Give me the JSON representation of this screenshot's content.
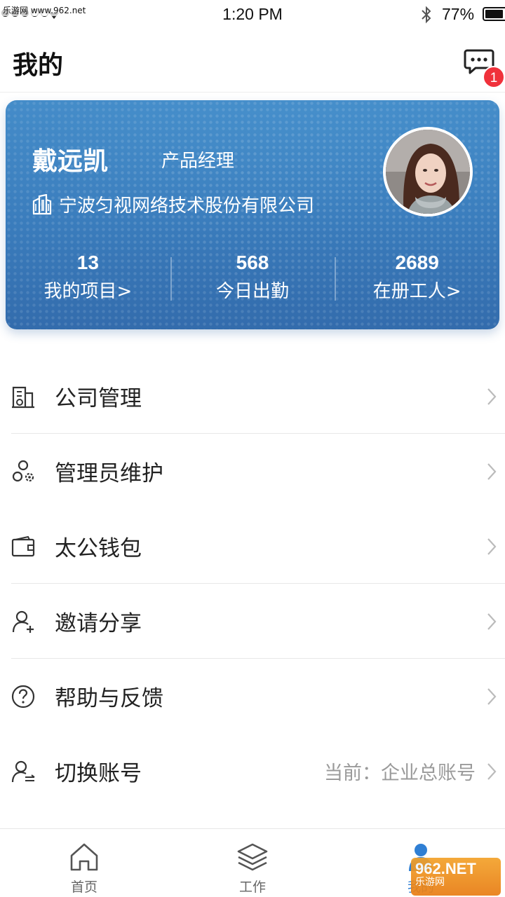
{
  "status_bar": {
    "watermark": "乐游网 www.962.net",
    "time": "1:20 PM",
    "battery": "77%",
    "battery_level": 0.77
  },
  "header": {
    "title": "我的",
    "message_badge": "1"
  },
  "profile": {
    "name": "戴远凯",
    "role": "产品经理",
    "company": "宁波匀视网络技术股份有限公司",
    "stats": [
      {
        "value": "13",
        "label": "我的项目>"
      },
      {
        "value": "568",
        "label": "今日出勤"
      },
      {
        "value": "2689",
        "label": "在册工人>"
      }
    ]
  },
  "menu": {
    "items": [
      {
        "label": "公司管理",
        "icon": "company-building-icon"
      },
      {
        "label": "管理员维护",
        "icon": "admin-gear-icon"
      },
      {
        "label": "太公钱包",
        "icon": "wallet-icon"
      },
      {
        "label": "邀请分享",
        "icon": "invite-user-icon"
      },
      {
        "label": "帮助与反馈",
        "icon": "help-icon"
      },
      {
        "label": "切换账号",
        "icon": "switch-account-icon",
        "value": "当前：企业总账号"
      }
    ]
  },
  "tabbar": {
    "tabs": [
      {
        "label": "首页",
        "icon": "home-icon"
      },
      {
        "label": "工作",
        "icon": "layers-icon"
      },
      {
        "label": "我的",
        "icon": "profile-icon",
        "active": true
      }
    ]
  },
  "corner_logo": {
    "main": "962.NET",
    "sub": "乐游网"
  },
  "colors": {
    "card_gradient_top": "#4a95d0",
    "card_gradient_bottom": "#2f63a4",
    "badge": "#f0313b",
    "active_tab": "#2f7fd4"
  }
}
